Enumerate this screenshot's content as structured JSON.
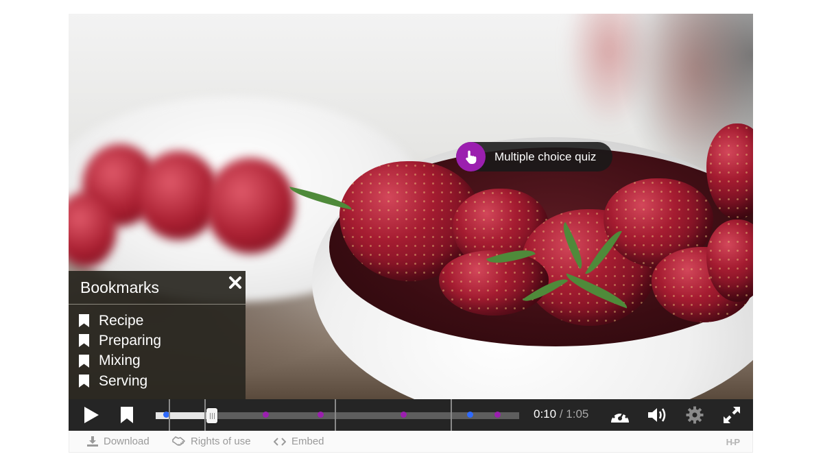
{
  "quiz_hotspot": {
    "label": "Multiple choice quiz",
    "color": "#9b1faf"
  },
  "bookmarks": {
    "title": "Bookmarks",
    "items": [
      {
        "label": "Recipe"
      },
      {
        "label": "Preparing"
      },
      {
        "label": "Mixing"
      },
      {
        "label": "Serving"
      }
    ]
  },
  "player": {
    "current_time": "0:10",
    "separator": "/",
    "total_time": "1:05",
    "progress_fraction": 0.154,
    "interaction_marker_colors": {
      "bookmark": "#2f6bff",
      "interaction": "#9b1faf"
    }
  },
  "footer": {
    "download_label": "Download",
    "rights_label": "Rights of use",
    "embed_label": "Embed",
    "logo_text": "H-P"
  }
}
